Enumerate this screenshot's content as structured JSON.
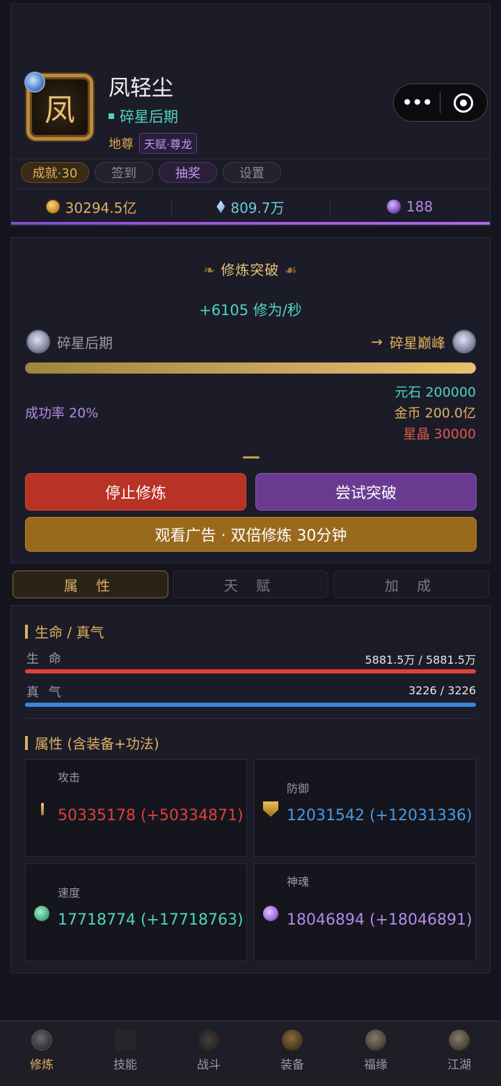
{
  "profile": {
    "avatar_char": "凤",
    "name": "凤轻尘",
    "realm": "碎星后期",
    "rank": "地尊",
    "talent": "天赋·尊龙"
  },
  "tags": {
    "achievement": "成就·30",
    "sign_in": "签到",
    "lottery": "抽奖",
    "settings": "设置"
  },
  "resources": {
    "gold": "30294.5亿",
    "stone": "809.7万",
    "crystal": "188"
  },
  "cultivation": {
    "title": "修炼突破",
    "rate": "+6105 修为/秒",
    "current_stage": "碎星后期",
    "arrow": "→",
    "next_stage": "碎星巅峰",
    "progress": 1.0,
    "cost_stone": "元石 200000",
    "cost_gold": "金币 200.0亿",
    "cost_star": "星晶 30000",
    "success_rate": "成功率 20%",
    "stop_label": "停止修炼",
    "break_label": "尝试突破",
    "ad_label": "观看广告 · 双倍修炼 30分钟"
  },
  "tabs": {
    "attr": "属 性",
    "talent": "天 赋",
    "bonus": "加 成"
  },
  "stats": {
    "section_vital": "生命 / 真气",
    "life_label": "生 命",
    "life_value": "5881.5万 / 5881.5万",
    "qi_label": "真 气",
    "qi_value": "3226 / 3226",
    "section_attr": "属性 (含装备+功法)",
    "cards": [
      {
        "label": "攻击",
        "value": "50335178 (+50334871)",
        "icon": "sword-icon"
      },
      {
        "label": "防御",
        "value": "12031542 (+12031336)",
        "icon": "shield-icon"
      },
      {
        "label": "速度",
        "value": "17718774 (+17718763)",
        "icon": "speed-icon"
      },
      {
        "label": "神魂",
        "value": "18046894 (+18046891)",
        "icon": "soul-icon"
      }
    ]
  },
  "nav": [
    {
      "label": "修炼",
      "active": true
    },
    {
      "label": "技能",
      "active": false
    },
    {
      "label": "战斗",
      "active": false
    },
    {
      "label": "装备",
      "active": false
    },
    {
      "label": "福缘",
      "active": false
    },
    {
      "label": "江湖",
      "active": false
    }
  ],
  "colors": {
    "accent_gold": "#e0b060",
    "accent_teal": "#4fd4c0",
    "accent_purple": "#b48ae8",
    "danger_red": "#e0403a",
    "info_blue": "#4a9ae0"
  }
}
